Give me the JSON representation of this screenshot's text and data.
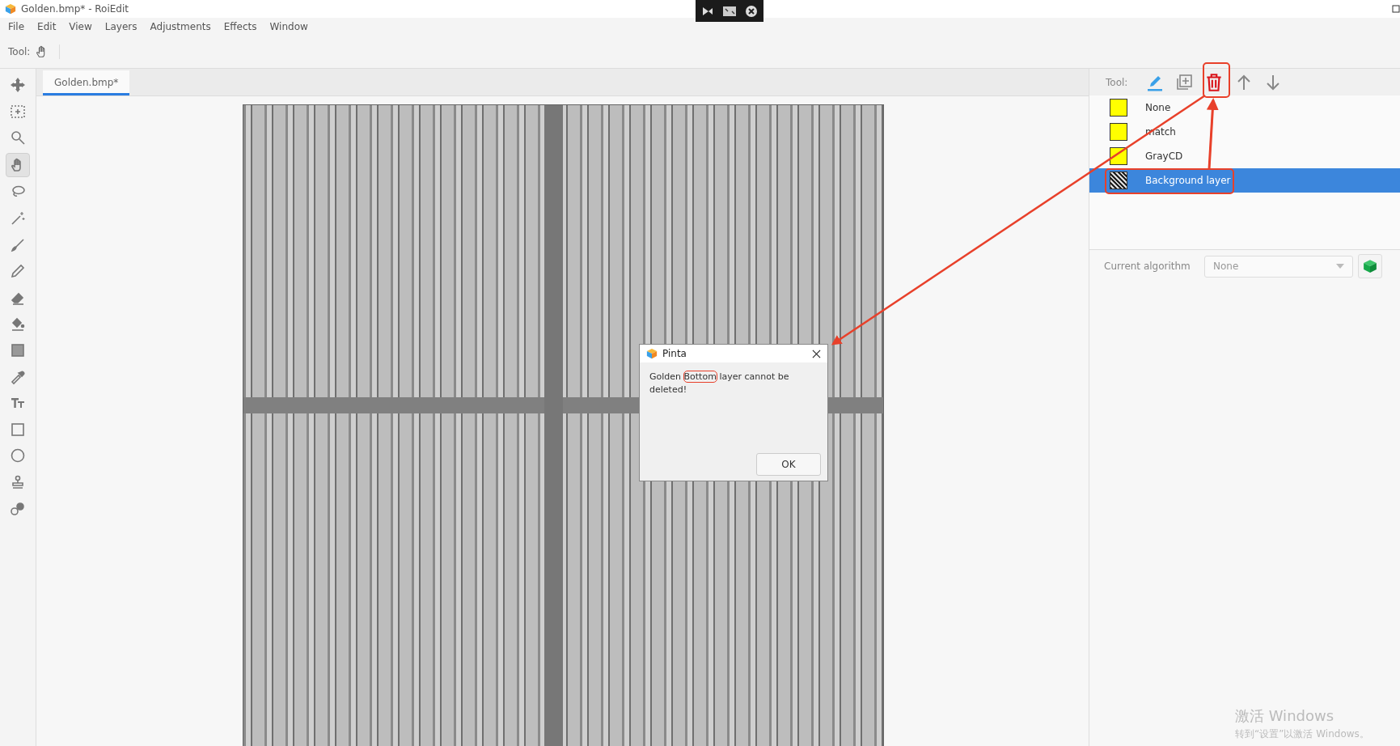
{
  "window": {
    "title": "Golden.bmp* - RoiEdit"
  },
  "menu": [
    "File",
    "Edit",
    "View",
    "Layers",
    "Adjustments",
    "Effects",
    "Window"
  ],
  "toolbar": {
    "label": "Tool:"
  },
  "tools": [
    {
      "kind": "move",
      "selected": false
    },
    {
      "kind": "select",
      "selected": false
    },
    {
      "kind": "zoom",
      "selected": false
    },
    {
      "kind": "pan",
      "selected": true
    },
    {
      "kind": "lasso",
      "selected": false
    },
    {
      "kind": "wand",
      "selected": false
    },
    {
      "kind": "brush",
      "selected": false
    },
    {
      "kind": "pencil",
      "selected": false
    },
    {
      "kind": "eraser",
      "selected": false
    },
    {
      "kind": "bucket",
      "selected": false
    },
    {
      "kind": "gradient",
      "selected": false
    },
    {
      "kind": "picker",
      "selected": false
    },
    {
      "kind": "text",
      "selected": false
    },
    {
      "kind": "rectangle",
      "selected": false
    },
    {
      "kind": "ellipse",
      "selected": false
    },
    {
      "kind": "stamp",
      "selected": false
    },
    {
      "kind": "recolor",
      "selected": false
    }
  ],
  "tabs": [
    {
      "label": "Golden.bmp*",
      "selected": true
    }
  ],
  "layers_panel": {
    "tool_label": "Tool:",
    "layers": [
      {
        "name": "None",
        "kind": "swatch",
        "color": "#ffff00",
        "selected": false
      },
      {
        "name": "match",
        "kind": "swatch",
        "color": "#ffff00",
        "selected": false
      },
      {
        "name": "GrayCD",
        "kind": "swatch",
        "color": "#ffff00",
        "selected": false
      },
      {
        "name": "Background layer",
        "kind": "thumbnail",
        "selected": true
      }
    ],
    "algorithm_label": "Current algorithm",
    "algorithm_placeholder": "None"
  },
  "dialog": {
    "title": "Pinta",
    "message_before": "Golden ",
    "message_highlight": "Bottom",
    "message_after": " layer cannot be deleted!",
    "button": "OK"
  },
  "activation_notice": {
    "title": "激活 Windows",
    "subtitle": "转到“设置”以激活 Windows。"
  }
}
